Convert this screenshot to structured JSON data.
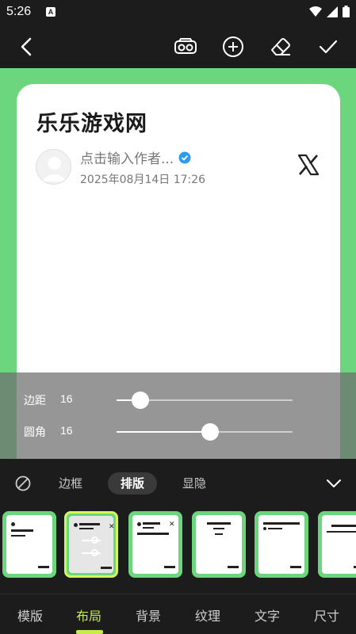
{
  "status": {
    "time": "5:26",
    "notif_icon": "A"
  },
  "toolbar": {
    "back_icon": "chevron-left-icon",
    "actions": [
      "vr-glasses-icon",
      "add-circle-icon",
      "eraser-icon",
      "check-icon"
    ]
  },
  "card": {
    "title": "乐乐游戏网",
    "author": "点击输入作者...",
    "date": "2025年08月14日 17:26",
    "platform_icon": "x-logo-icon"
  },
  "sliders": [
    {
      "label": "边距",
      "value": "16",
      "fraction": 0.135
    },
    {
      "label": "圆角",
      "value": "16",
      "fraction": 0.53
    }
  ],
  "subtabs": {
    "none_icon": "no-style-icon",
    "items": [
      "边框",
      "排版",
      "显隐"
    ],
    "active": "排版",
    "collapse_icon": "chevron-down-icon"
  },
  "layouts": {
    "selected_index": 1,
    "count": 6
  },
  "maintabs": {
    "items": [
      "模版",
      "布局",
      "背景",
      "纹理",
      "文字",
      "尺寸"
    ],
    "active": "布局"
  },
  "colors": {
    "canvas_bg": "#6cd67f",
    "accent": "#c5ec4c",
    "verified": "#2e9bf0"
  }
}
